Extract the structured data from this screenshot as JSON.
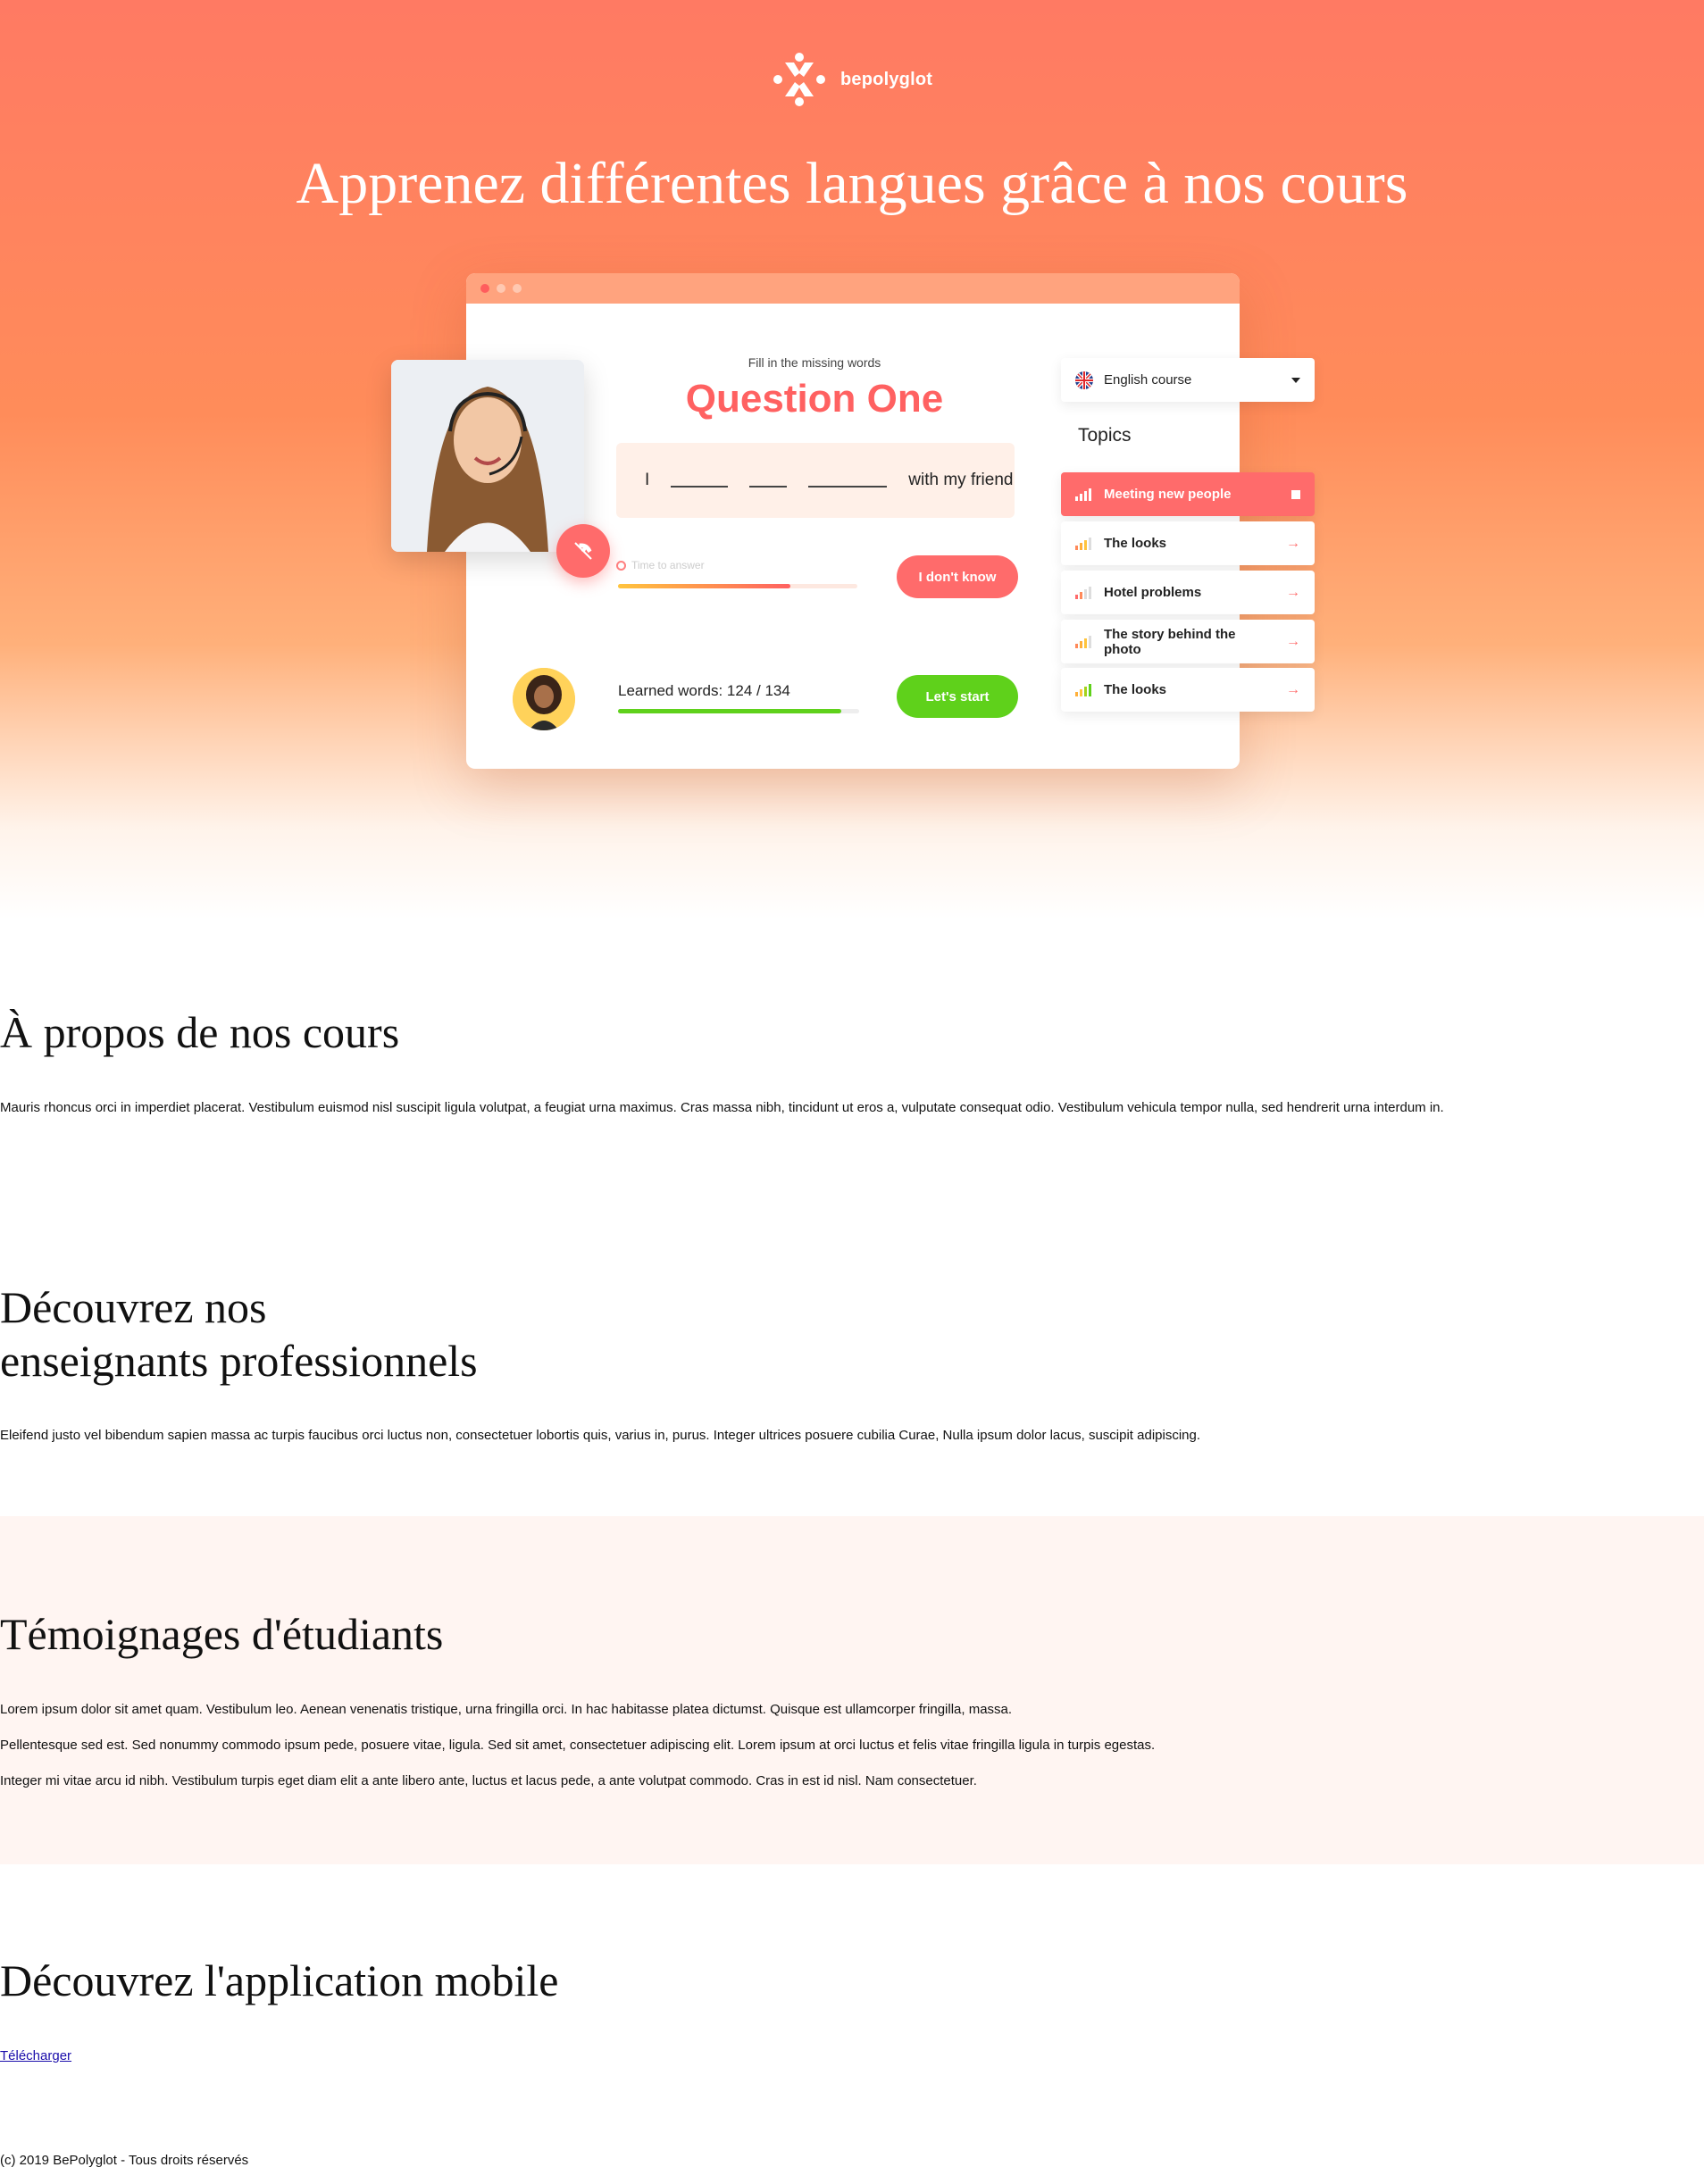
{
  "brand": {
    "name": "bepolyglot"
  },
  "hero": {
    "title": "Apprenez différentes langues grâce à nos cours"
  },
  "mockup": {
    "hint": "Fill in the missing words",
    "question": "Question One",
    "sentence_start": "I",
    "sentence_end": "with my friend",
    "timer_label": "Time to answer",
    "timer_progress": 0.72,
    "dont_know": "I don't know",
    "learned_label": "Learned words: 124 / 134",
    "learned_progress": 0.925,
    "start": "Let's start",
    "course": "English course",
    "topics_title": "Topics",
    "topics": [
      {
        "label": "Meeting new people",
        "level": 4
      },
      {
        "label": "The looks",
        "level": 3
      },
      {
        "label": "Hotel problems",
        "level": 2
      },
      {
        "label": "The story behind the photo",
        "level": 3
      },
      {
        "label": "The looks",
        "level": 4
      }
    ],
    "accent": "#ff6b6b",
    "success": "#5fd11b"
  },
  "about": {
    "title": "À propos de nos cours",
    "text": "Mauris rhoncus orci in imperdiet placerat. Vestibulum euismod nisl suscipit ligula volutpat, a feugiat urna maximus. Cras massa nibh, tincidunt ut eros a, vulputate consequat odio. Vestibulum vehicula tempor nulla, sed hendrerit urna interdum in."
  },
  "teachers": {
    "title_line1": "Découvrez nos",
    "title_line2": "enseignants professionnels",
    "text": "Eleifend justo vel bibendum sapien massa ac turpis faucibus orci luctus non, consectetuer lobortis quis, varius in, purus. Integer ultrices posuere cubilia Curae, Nulla ipsum dolor lacus, suscipit adipiscing."
  },
  "testimonials": {
    "title": "Témoignages d'étudiants",
    "items": [
      "Lorem ipsum dolor sit amet quam. Vestibulum leo. Aenean venenatis tristique, urna fringilla orci. In hac habitasse platea dictumst. Quisque est ullamcorper fringilla, massa.",
      "Pellentesque sed est. Sed nonummy commodo ipsum pede, posuere vitae, ligula. Sed sit amet, consectetuer adipiscing elit. Lorem ipsum at orci luctus et felis vitae fringilla ligula in turpis egestas.",
      "Integer mi vitae arcu id nibh. Vestibulum turpis eget diam elit a ante libero ante, luctus et lacus pede, a ante volutpat commodo. Cras in est id nisl. Nam consectetuer."
    ]
  },
  "app": {
    "title": "Découvrez l'application mobile",
    "download": "Télécharger"
  },
  "footer": {
    "text": "(c) 2019 BePolyglot - Tous droits réservés"
  }
}
